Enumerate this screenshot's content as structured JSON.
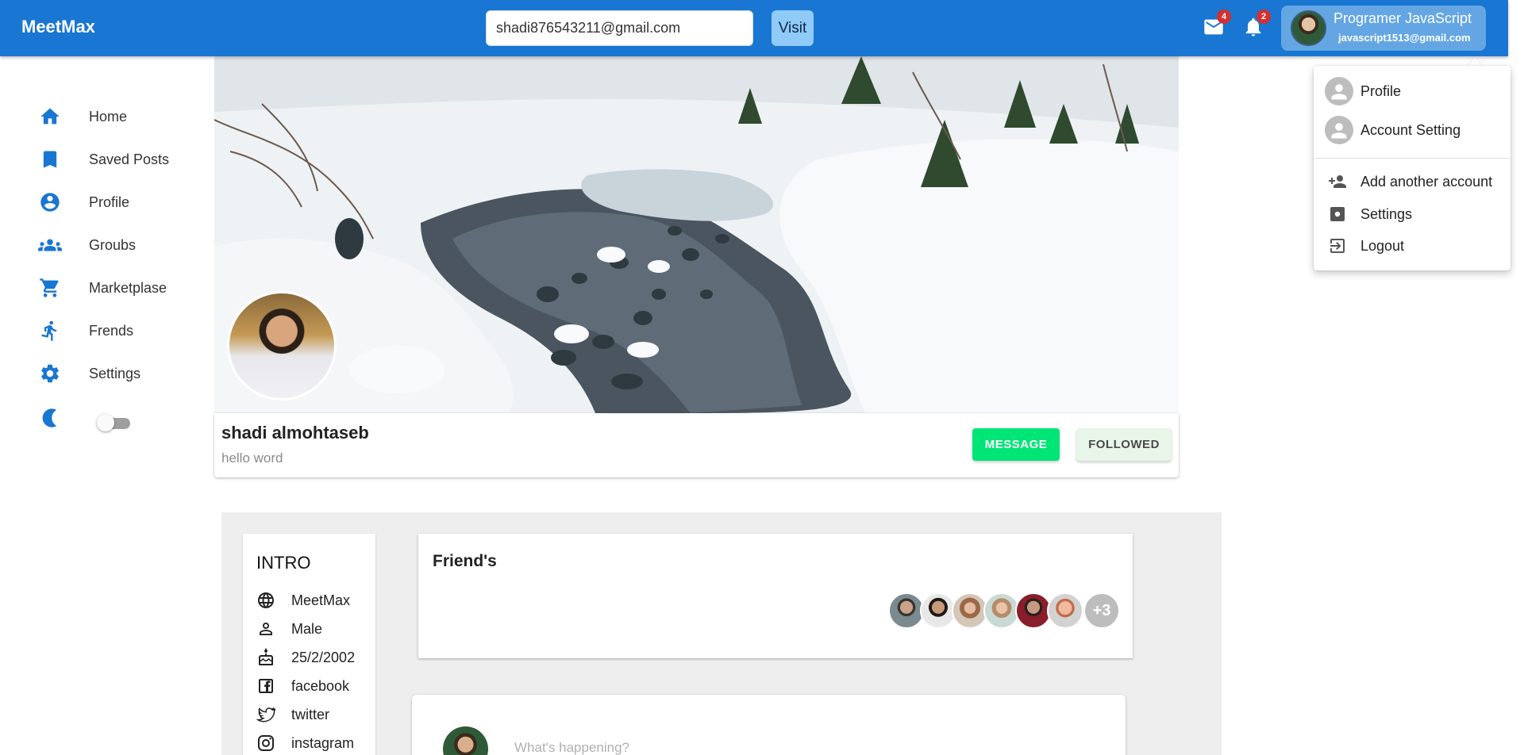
{
  "appbar": {
    "brand": "MeetMax",
    "search_value": "shadi876543211@gmail.com",
    "visit_label": "Visit",
    "mail_badge": "4",
    "notification_badge": "2",
    "account_name": "Programer JavaScript",
    "account_email": "javascript1513@gmail.com"
  },
  "sidebar": {
    "items": [
      {
        "label": "Home",
        "icon": "home-icon"
      },
      {
        "label": "Saved Posts",
        "icon": "bookmark-icon"
      },
      {
        "label": "Profile",
        "icon": "account-circle-icon"
      },
      {
        "label": "Groubs",
        "icon": "groups-icon"
      },
      {
        "label": "Marketplase",
        "icon": "cart-icon"
      },
      {
        "label": "Frends",
        "icon": "running-person-icon"
      },
      {
        "label": "Settings",
        "icon": "gear-icon"
      }
    ],
    "dark_mode_icon": "moon-icon"
  },
  "profile": {
    "name": "shadi almohtaseb",
    "bio": "hello word",
    "message_label": "MESSAGE",
    "followed_label": "FOLLOWED"
  },
  "intro": {
    "title": "INTRO",
    "rows": [
      {
        "icon": "globe-icon",
        "text": "MeetMax"
      },
      {
        "icon": "person-icon",
        "text": "Male"
      },
      {
        "icon": "cake-icon",
        "text": "25/2/2002"
      },
      {
        "icon": "facebook-icon",
        "text": "facebook"
      },
      {
        "icon": "twitter-icon",
        "text": "twitter"
      },
      {
        "icon": "instagram-icon",
        "text": "instagram"
      }
    ]
  },
  "friends": {
    "title": "Friend's",
    "more": "+3"
  },
  "post": {
    "placeholder": "What's happening?"
  },
  "menu": {
    "items": [
      {
        "label": "Profile",
        "icon": "avatar-icon"
      },
      {
        "label": "Account Setting",
        "icon": "avatar-icon"
      },
      {
        "label": "Add another account",
        "icon": "person-add-icon"
      },
      {
        "label": "Settings",
        "icon": "settings-icon"
      },
      {
        "label": "Logout",
        "icon": "logout-icon"
      }
    ]
  },
  "colors": {
    "primary": "#1976d2",
    "message_button": "#00e676",
    "badge": "#d32f2f"
  }
}
